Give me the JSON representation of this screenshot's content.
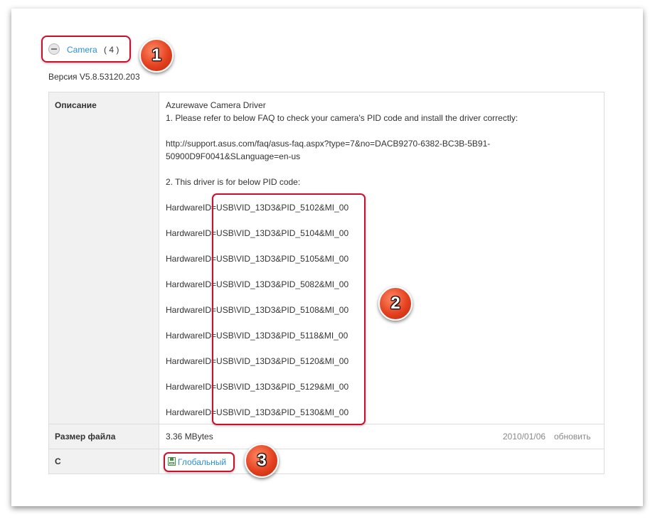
{
  "category": {
    "name": "Camera",
    "count": "( 4 )"
  },
  "version": "Версия V5.8.53120.203",
  "table": {
    "description_label": "Описание",
    "description_lines": [
      "Azurewave Camera Driver",
      "1. Please refer to below FAQ to check your camera's PID code and install the driver correctly:",
      "http://support.asus.com/faq/asus-faq.aspx?type=7&no=DACB9270-6382-BC3B-5B91-",
      "50900D9F0041&SLanguage=en-us",
      "2. This driver is for below PID code:"
    ],
    "hardware_ids": [
      "HardwareID=USB\\VID_13D3&PID_5102&MI_00",
      "HardwareID=USB\\VID_13D3&PID_5104&MI_00",
      "HardwareID=USB\\VID_13D3&PID_5105&MI_00",
      "HardwareID=USB\\VID_13D3&PID_5082&MI_00",
      "HardwareID=USB\\VID_13D3&PID_5108&MI_00",
      "HardwareID=USB\\VID_13D3&PID_5118&MI_00",
      "HardwareID=USB\\VID_13D3&PID_5120&MI_00",
      "HardwareID=USB\\VID_13D3&PID_5129&MI_00",
      "HardwareID=USB\\VID_13D3&PID_5130&MI_00"
    ],
    "size_label": "Размер файла",
    "size_value": "3.36 MBytes",
    "date": "2010/01/06",
    "update_label": "обновить",
    "source_label": "С",
    "download_label": "Глобальный"
  },
  "markers": [
    "1",
    "2",
    "3"
  ],
  "icons": {
    "collapse": "minus-circle-icon",
    "download": "floppy-disk-icon"
  },
  "colors": {
    "link": "#2a8fd0",
    "highlight": "#c8102e",
    "marker": "#e4411f"
  }
}
